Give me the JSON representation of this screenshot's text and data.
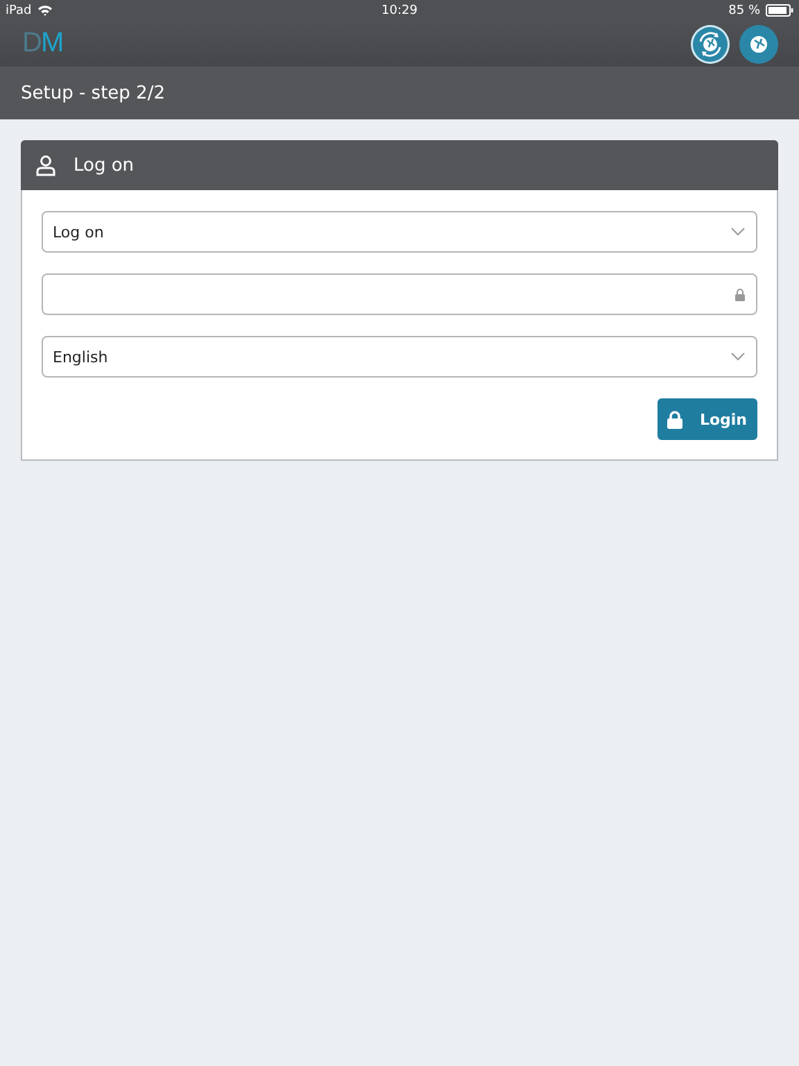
{
  "status_bar": {
    "device": "iPad",
    "time": "10:29",
    "battery": "85 %"
  },
  "app_bar": {
    "logo": "DM"
  },
  "step_bar": {
    "title": "Setup - step 2/2"
  },
  "card": {
    "title": "Log on",
    "fields": [
      {
        "kind": "dropdown",
        "value": "Log on"
      },
      {
        "kind": "password"
      },
      {
        "kind": "dropdown",
        "value": "English"
      }
    ],
    "button": "Login"
  }
}
